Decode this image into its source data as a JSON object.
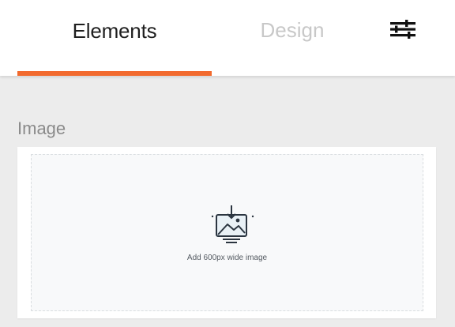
{
  "tabs": {
    "elements": {
      "label": "Elements",
      "active": true
    },
    "design": {
      "label": "Design",
      "active": false
    }
  },
  "settings": {
    "icon": "sliders-icon"
  },
  "section": {
    "label": "Image"
  },
  "image_block": {
    "icon": "image-upload-icon",
    "hint": "Add 600px wide image"
  },
  "colors": {
    "accent": "#f26a2e",
    "background": "#ececec",
    "active_tab_text": "#1f1f1f",
    "inactive_tab_text": "#c8c8c8",
    "section_label": "#8a8a8a"
  }
}
